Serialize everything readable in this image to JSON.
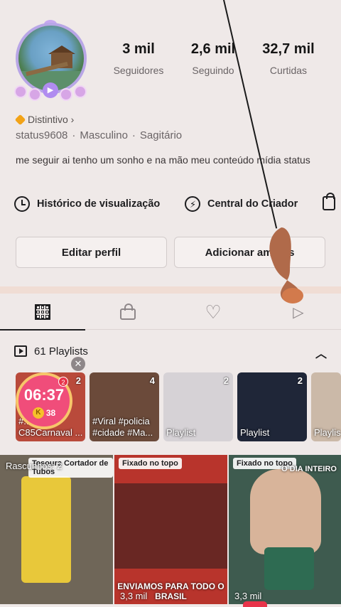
{
  "profile": {
    "stats": [
      {
        "value": "3 mil",
        "label": "Seguidores"
      },
      {
        "value": "2,6 mil",
        "label": "Seguindo"
      },
      {
        "value": "32,7 mil",
        "label": "Curtidas"
      }
    ],
    "badge": "Distintivo ›",
    "meta": [
      "status9608",
      "·",
      "Masculino",
      "·",
      "Sagitário"
    ],
    "bio": "me seguir ai tenho um sonho e na mão meu conteúdo mídia status"
  },
  "tools": {
    "history": "Histórico de visualização",
    "creator": "Central do Criador"
  },
  "buttons": {
    "edit": "Editar perfil",
    "add": "Adicionar amigos"
  },
  "playlists": {
    "header": "61 Playlists",
    "cards": [
      {
        "count": "2",
        "title": "#...me C85Carnaval ...",
        "color": "#b94a3b"
      },
      {
        "count": "4",
        "title": "#Viral #policia #cidade #Ma...",
        "color": "#6b4a3a"
      },
      {
        "count": "2",
        "title": "Playlist",
        "color": "#d6d2d6"
      },
      {
        "count": "2",
        "title": "Playlist",
        "color": "#1f2638"
      },
      {
        "count": "",
        "title": "Playlis",
        "color": "#cbb9a8"
      }
    ]
  },
  "timer": {
    "time": "06:37",
    "coins": "38",
    "coin_letter": "K",
    "badge": "2"
  },
  "videos": [
    {
      "caption": "Tesoura Cortador de Tubos",
      "views": "",
      "label": "Rascunhos: 2",
      "overlay": "",
      "color": "#6f6658"
    },
    {
      "caption": "Fixado no topo",
      "views": "3,3 mil",
      "label": "",
      "overlay": "ENVIAMOS PARA TODO O BRASIL",
      "color": "#b8342c"
    },
    {
      "caption": "Fixado no topo",
      "views": "3,3 mil",
      "label": "",
      "overlay": "O DIA INTEIRO",
      "color": "#3e5b4f"
    }
  ],
  "colors": {
    "accent": "#e8344a",
    "background": "#efe9e8",
    "badge": "#f2a317"
  }
}
